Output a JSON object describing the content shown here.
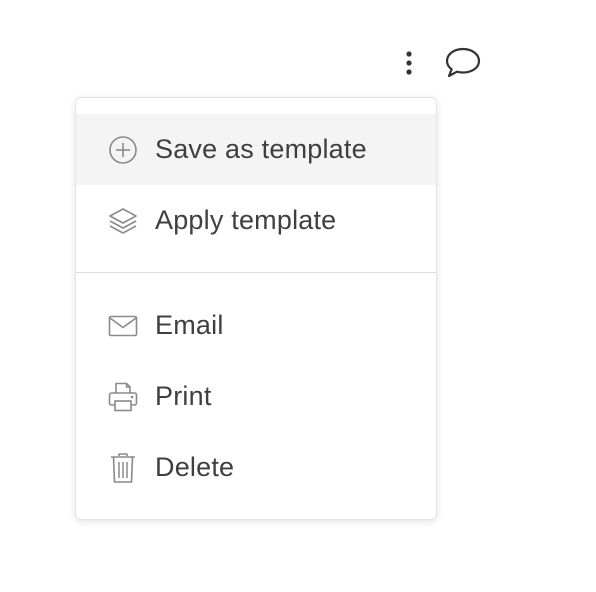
{
  "toolbar": {
    "more_icon": "kebab-vertical-icon",
    "comment_icon": "speech-bubble-icon"
  },
  "menu": {
    "items": [
      {
        "label": "Save as template",
        "icon": "plus-circle-icon",
        "highlighted": true
      },
      {
        "label": "Apply template",
        "icon": "layers-icon"
      },
      {
        "label": "Email",
        "icon": "envelope-icon"
      },
      {
        "label": "Print",
        "icon": "printer-icon"
      },
      {
        "label": "Delete",
        "icon": "trash-icon"
      }
    ]
  },
  "colors": {
    "text": "#3f3f3f",
    "icon": "#8a8a8a",
    "highlight": "#f4f4f4",
    "border": "#e4e4e4"
  }
}
